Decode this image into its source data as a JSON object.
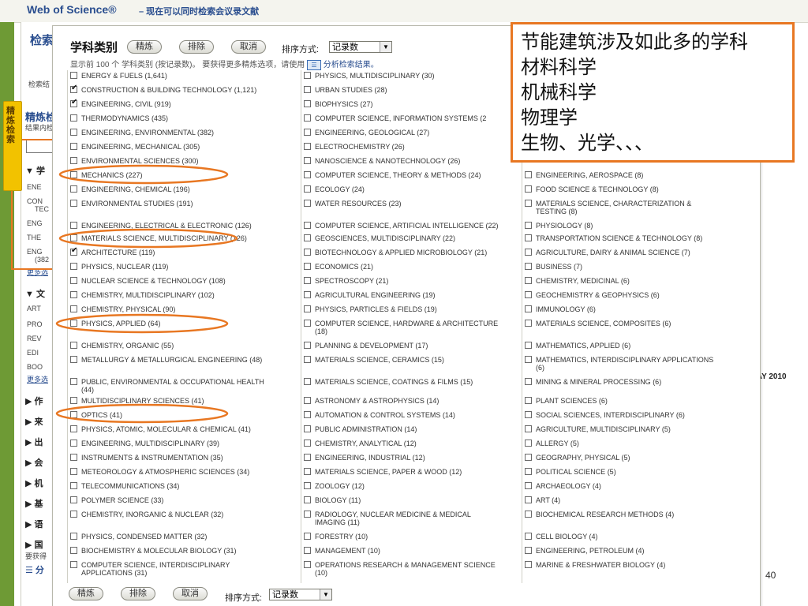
{
  "topbar": {
    "title": "Web of Science®",
    "subtitle": "– 现在可以同时检索会议录文献"
  },
  "sidetab": "精炼检索",
  "bg": {
    "search_heading": "检索",
    "results_label": "检索结",
    "refine_heading": "精炼检",
    "refine_sub": "结果内检",
    "subject_items": [
      "ENE",
      "CON",
      "TEC",
      "ENG",
      "THE",
      "ENG",
      "(382"
    ],
    "more_link": "更多选",
    "doctype_items": [
      "ART",
      "PRO",
      "REV",
      "EDI",
      "BOO"
    ],
    "sections": [
      "▼ 学",
      "▼ 文",
      "▶ 作",
      "▶ 来",
      "▶ 出",
      "▶ 会",
      "▶ 机",
      "▶ 基",
      "▶ 语",
      "▶ 国"
    ],
    "footnote": "要获得",
    "analyze": "☰ 分",
    "date_fragment": "IAY 2010"
  },
  "panel": {
    "title": "学科类别",
    "buttons": {
      "refine": "精炼",
      "exclude": "排除",
      "cancel": "取消"
    },
    "sort_label": "排序方式:",
    "sort_value": "记录数",
    "info_text": "显示前 100 个 学科类别 (按记录数)。 要获得更多精炼选项，请使用 ",
    "info_link": " 分析检索结果。",
    "columns": [
      [
        {
          "label": "ENERGY & FUELS (1,641)",
          "checked": false
        },
        {
          "label": "CONSTRUCTION & BUILDING TECHNOLOGY (1,121)",
          "checked": true
        },
        {
          "label": "ENGINEERING, CIVIL (919)",
          "checked": true
        },
        {
          "label": "THERMODYNAMICS (435)",
          "checked": false
        },
        {
          "label": "ENGINEERING, ENVIRONMENTAL (382)",
          "checked": false
        },
        {
          "label": "ENGINEERING, MECHANICAL (305)",
          "checked": false
        },
        {
          "label": "ENVIRONMENTAL SCIENCES (300)",
          "checked": false
        },
        {
          "label": "MECHANICS (227)",
          "checked": false
        },
        {
          "label": "ENGINEERING, CHEMICAL (196)",
          "checked": false
        },
        {
          "label": "ENVIRONMENTAL STUDIES (191)",
          "checked": false
        },
        {
          "label": "ENGINEERING, ELECTRICAL & ELECTRONIC (126)",
          "checked": false
        },
        {
          "label": "MATERIALS SCIENCE, MULTIDISCIPLINARY (126)",
          "checked": false
        },
        {
          "label": "ARCHITECTURE (119)",
          "checked": true
        },
        {
          "label": "PHYSICS, NUCLEAR (119)",
          "checked": false
        },
        {
          "label": "NUCLEAR SCIENCE & TECHNOLOGY (108)",
          "checked": false
        },
        {
          "label": "CHEMISTRY, MULTIDISCIPLINARY (102)",
          "checked": false
        },
        {
          "label": "CHEMISTRY, PHYSICAL (90)",
          "checked": false
        },
        {
          "label": "PHYSICS, APPLIED (64)",
          "checked": false
        },
        {
          "label": "CHEMISTRY, ORGANIC (55)",
          "checked": false
        },
        {
          "label": "METALLURGY & METALLURGICAL ENGINEERING (48)",
          "checked": false
        },
        {
          "label": "PUBLIC, ENVIRONMENTAL & OCCUPATIONAL HEALTH",
          "label2": "(44)",
          "checked": false
        },
        {
          "label": "MULTIDISCIPLINARY SCIENCES (41)",
          "checked": false
        },
        {
          "label": "OPTICS (41)",
          "checked": false
        },
        {
          "label": "PHYSICS, ATOMIC, MOLECULAR & CHEMICAL (41)",
          "checked": false
        },
        {
          "label": "ENGINEERING, MULTIDISCIPLINARY (39)",
          "checked": false
        },
        {
          "label": "INSTRUMENTS & INSTRUMENTATION (35)",
          "checked": false
        },
        {
          "label": "METEOROLOGY & ATMOSPHERIC SCIENCES (34)",
          "checked": false
        },
        {
          "label": "TELECOMMUNICATIONS (34)",
          "checked": false
        },
        {
          "label": "POLYMER SCIENCE (33)",
          "checked": false
        },
        {
          "label": "CHEMISTRY, INORGANIC & NUCLEAR (32)",
          "checked": false
        },
        {
          "label": "PHYSICS, CONDENSED MATTER (32)",
          "checked": false
        },
        {
          "label": "BIOCHEMISTRY & MOLECULAR BIOLOGY (31)",
          "checked": false
        },
        {
          "label": "COMPUTER SCIENCE, INTERDISCIPLINARY",
          "label2": "APPLICATIONS (31)",
          "checked": false
        }
      ],
      [
        {
          "label": "PHYSICS, MULTIDISCIPLINARY (30)",
          "checked": false
        },
        {
          "label": "URBAN STUDIES (28)",
          "checked": false
        },
        {
          "label": "BIOPHYSICS (27)",
          "checked": false
        },
        {
          "label": "COMPUTER SCIENCE, INFORMATION SYSTEMS (2",
          "checked": false
        },
        {
          "label": "ENGINEERING, GEOLOGICAL (27)",
          "checked": false
        },
        {
          "label": "ELECTROCHEMISTRY (26)",
          "checked": false
        },
        {
          "label": "NANOSCIENCE & NANOTECHNOLOGY (26)",
          "checked": false
        },
        {
          "label": "COMPUTER SCIENCE, THEORY & METHODS (24)",
          "checked": false
        },
        {
          "label": "ECOLOGY (24)",
          "checked": false
        },
        {
          "label": "WATER RESOURCES (23)",
          "checked": false
        },
        {
          "label": "COMPUTER SCIENCE, ARTIFICIAL INTELLIGENCE (22)",
          "checked": false
        },
        {
          "label": "GEOSCIENCES, MULTIDISCIPLINARY (22)",
          "checked": false
        },
        {
          "label": "BIOTECHNOLOGY & APPLIED MICROBIOLOGY (21)",
          "checked": false
        },
        {
          "label": "ECONOMICS (21)",
          "checked": false
        },
        {
          "label": "SPECTROSCOPY (21)",
          "checked": false
        },
        {
          "label": "AGRICULTURAL ENGINEERING (19)",
          "checked": false
        },
        {
          "label": "PHYSICS, PARTICLES & FIELDS (19)",
          "checked": false
        },
        {
          "label": "COMPUTER SCIENCE, HARDWARE & ARCHITECTURE",
          "label2": "(18)",
          "checked": false
        },
        {
          "label": "PLANNING & DEVELOPMENT (17)",
          "checked": false
        },
        {
          "label": "MATERIALS SCIENCE, CERAMICS (15)",
          "checked": false
        },
        {
          "label": "MATERIALS SCIENCE, COATINGS & FILMS (15)",
          "checked": false
        },
        {
          "label": "ASTRONOMY & ASTROPHYSICS (14)",
          "checked": false
        },
        {
          "label": "AUTOMATION & CONTROL SYSTEMS (14)",
          "checked": false
        },
        {
          "label": "PUBLIC ADMINISTRATION (14)",
          "checked": false
        },
        {
          "label": "CHEMISTRY, ANALYTICAL (12)",
          "checked": false
        },
        {
          "label": "ENGINEERING, INDUSTRIAL (12)",
          "checked": false
        },
        {
          "label": "MATERIALS SCIENCE, PAPER & WOOD (12)",
          "checked": false
        },
        {
          "label": "ZOOLOGY (12)",
          "checked": false
        },
        {
          "label": "BIOLOGY (11)",
          "checked": false
        },
        {
          "label": "RADIOLOGY, NUCLEAR MEDICINE & MEDICAL",
          "label2": "IMAGING (11)",
          "checked": false
        },
        {
          "label": "FORESTRY (10)",
          "checked": false
        },
        {
          "label": "MANAGEMENT (10)",
          "checked": false
        },
        {
          "label": "OPERATIONS RESEARCH & MANAGEMENT SCIENCE",
          "label2": "(10)",
          "checked": false
        }
      ],
      [
        {
          "label": "ENGINEERING, AEROSPACE (8)",
          "checked": false
        },
        {
          "label": "FOOD SCIENCE & TECHNOLOGY (8)",
          "checked": false
        },
        {
          "label": "MATERIALS SCIENCE, CHARACTERIZATION &",
          "label2": "TESTING (8)",
          "checked": false
        },
        {
          "label": "PHYSIOLOGY (8)",
          "checked": false
        },
        {
          "label": "TRANSPORTATION SCIENCE & TECHNOLOGY (8)",
          "checked": false
        },
        {
          "label": "AGRICULTURE, DAIRY & ANIMAL SCIENCE (7)",
          "checked": false
        },
        {
          "label": "BUSINESS (7)",
          "checked": false
        },
        {
          "label": "CHEMISTRY, MEDICINAL (6)",
          "checked": false
        },
        {
          "label": "GEOCHEMISTRY & GEOPHYSICS (6)",
          "checked": false
        },
        {
          "label": "IMMUNOLOGY (6)",
          "checked": false
        },
        {
          "label": "MATERIALS SCIENCE, COMPOSITES (6)",
          "checked": false
        },
        {
          "label": "MATHEMATICS, APPLIED (6)",
          "checked": false
        },
        {
          "label": "MATHEMATICS, INTERDISCIPLINARY APPLICATIONS",
          "label2": "(6)",
          "checked": false
        },
        {
          "label": "MINING & MINERAL PROCESSING (6)",
          "checked": false
        },
        {
          "label": "PLANT SCIENCES (6)",
          "checked": false
        },
        {
          "label": "SOCIAL SCIENCES, INTERDISCIPLINARY (6)",
          "checked": false
        },
        {
          "label": "AGRICULTURE, MULTIDISCIPLINARY (5)",
          "checked": false
        },
        {
          "label": "ALLERGY (5)",
          "checked": false
        },
        {
          "label": "GEOGRAPHY, PHYSICAL (5)",
          "checked": false
        },
        {
          "label": "POLITICAL SCIENCE (5)",
          "checked": false
        },
        {
          "label": "ARCHAEOLOGY (4)",
          "checked": false
        },
        {
          "label": "ART (4)",
          "checked": false
        },
        {
          "label": "BIOCHEMICAL RESEARCH METHODS (4)",
          "checked": false
        },
        {
          "label": "CELL BIOLOGY (4)",
          "checked": false
        },
        {
          "label": "ENGINEERING, PETROLEUM (4)",
          "checked": false
        },
        {
          "label": "MARINE & FRESHWATER BIOLOGY (4)",
          "checked": false
        }
      ]
    ]
  },
  "callout": [
    "节能建筑涉及如此多的学科",
    "材料科学",
    "机械科学",
    "物理学",
    "生物、光学、、、"
  ],
  "page_number": "40"
}
